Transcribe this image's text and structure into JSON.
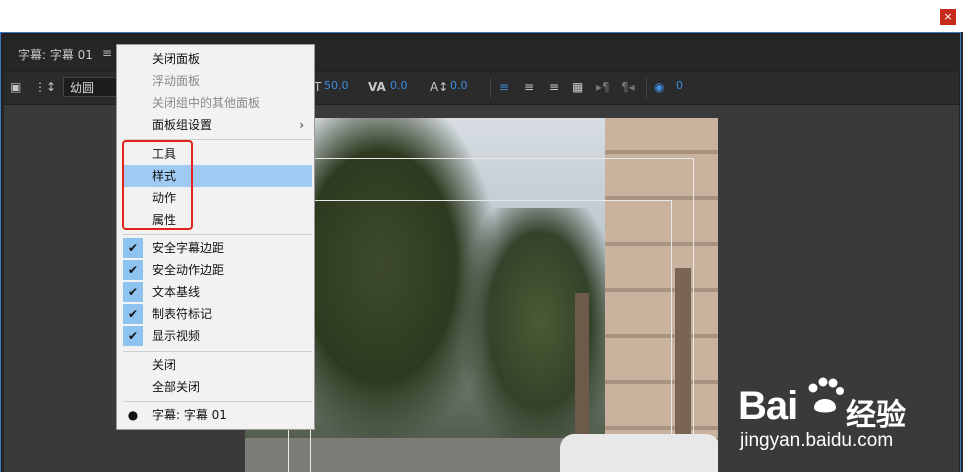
{
  "window": {
    "close_label": "×"
  },
  "panel": {
    "tab_title": "字幕: 字幕 01",
    "menu_icon": "≡"
  },
  "toolbar": {
    "font_value": "幼圆",
    "leading_value": "50.0",
    "kerning_value": "0.0",
    "baseline_value": "0.0",
    "tab_value": "0"
  },
  "menu": {
    "items": [
      {
        "label": "关闭面板",
        "enabled": true
      },
      {
        "label": "浮动面板",
        "enabled": false
      },
      {
        "label": "关闭组中的其他面板",
        "enabled": false
      },
      {
        "label": "面板组设置",
        "enabled": true,
        "submenu": true
      },
      {
        "label": "工具",
        "enabled": true
      },
      {
        "label": "样式",
        "enabled": true,
        "highlighted": true
      },
      {
        "label": "动作",
        "enabled": true
      },
      {
        "label": "属性",
        "enabled": true
      },
      {
        "label": "安全字幕边距",
        "checked": true
      },
      {
        "label": "安全动作边距",
        "checked": true
      },
      {
        "label": "文本基线",
        "checked": true
      },
      {
        "label": "制表符标记",
        "checked": true
      },
      {
        "label": "显示视频",
        "checked": true
      },
      {
        "label": "关闭",
        "enabled": true
      },
      {
        "label": "全部关闭",
        "enabled": true
      },
      {
        "label": "字幕: 字幕 01",
        "selected": true
      }
    ],
    "submenu_arrow": "›",
    "check_glyph": "✔",
    "bullet_glyph": "●"
  },
  "watermark": {
    "logo_text": "Bai",
    "logo_text2": "经验",
    "url": "jingyan.baidu.com"
  },
  "colors": {
    "accent_blue": "#3d8de0",
    "highlight": "#9fcbf2",
    "annotation_red": "#e2231a"
  }
}
